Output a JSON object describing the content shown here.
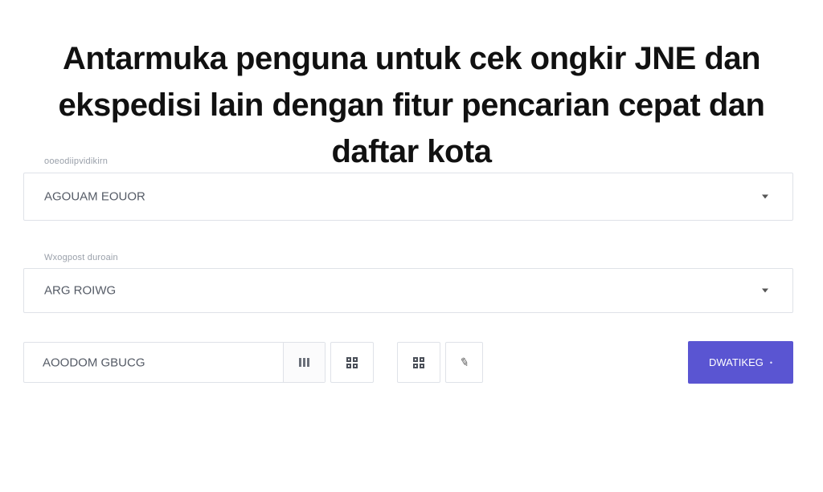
{
  "page": {
    "title": "Antarmuka penguna untuk cek ongkir JNE dan ekspedisi lain dengan fitur pencarian cepat dan daftar kota"
  },
  "form": {
    "origin": {
      "label": "ooeodiipvidikirn",
      "value": "AGOUAM EOUOR"
    },
    "destination": {
      "label": "Wxogpost duroain",
      "value": "ARG ROIWG"
    },
    "search": {
      "value": "AOODOM GBUCG"
    },
    "submit_label": "DWATIKEG",
    "submit_icon": "•"
  },
  "colors": {
    "accent": "#5a55d2",
    "border": "#dfe2e8"
  },
  "icons": [
    "barcode-icon",
    "qr-icon",
    "qr-icon",
    "pencil-icon"
  ]
}
